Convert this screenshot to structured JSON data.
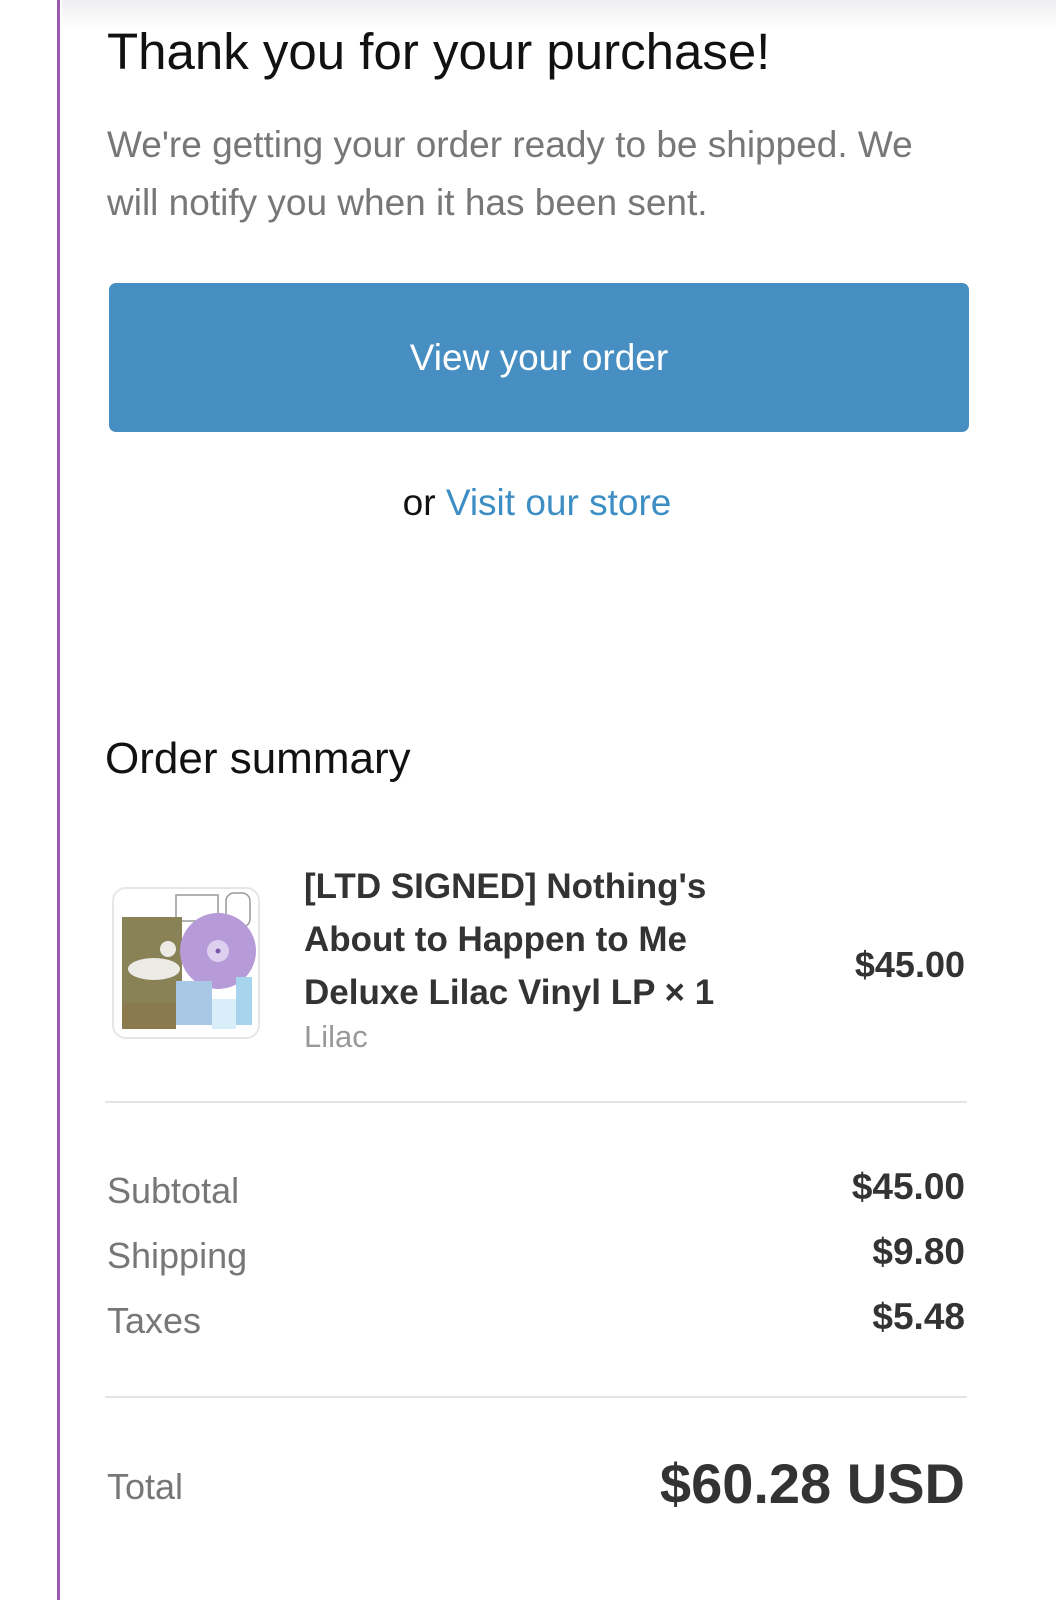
{
  "header": {
    "title": "Thank you for your purchase!",
    "subtitle": "We're getting your order ready to be shipped. We will notify you when it has been sent."
  },
  "actions": {
    "view_order_label": "View your order",
    "or_text": "or",
    "visit_store_label": "Visit our store"
  },
  "order_summary": {
    "title": "Order summary",
    "items": [
      {
        "name": "[LTD SIGNED] Nothing's About to Happen to Me Deluxe Lilac Vinyl LP × 1",
        "variant": "Lilac",
        "price": "$45.00",
        "thumbnail_icon": "vinyl-record-product-photo"
      }
    ],
    "subtotal_label": "Subtotal",
    "subtotal_value": "$45.00",
    "shipping_label": "Shipping",
    "shipping_value": "$9.80",
    "taxes_label": "Taxes",
    "taxes_value": "$5.48",
    "total_label": "Total",
    "total_value": "$60.28 USD"
  },
  "colors": {
    "button": "#478fc2",
    "link": "#3d8ec4",
    "side_border": "#9b59b6",
    "vinyl": "#b79ad8"
  }
}
